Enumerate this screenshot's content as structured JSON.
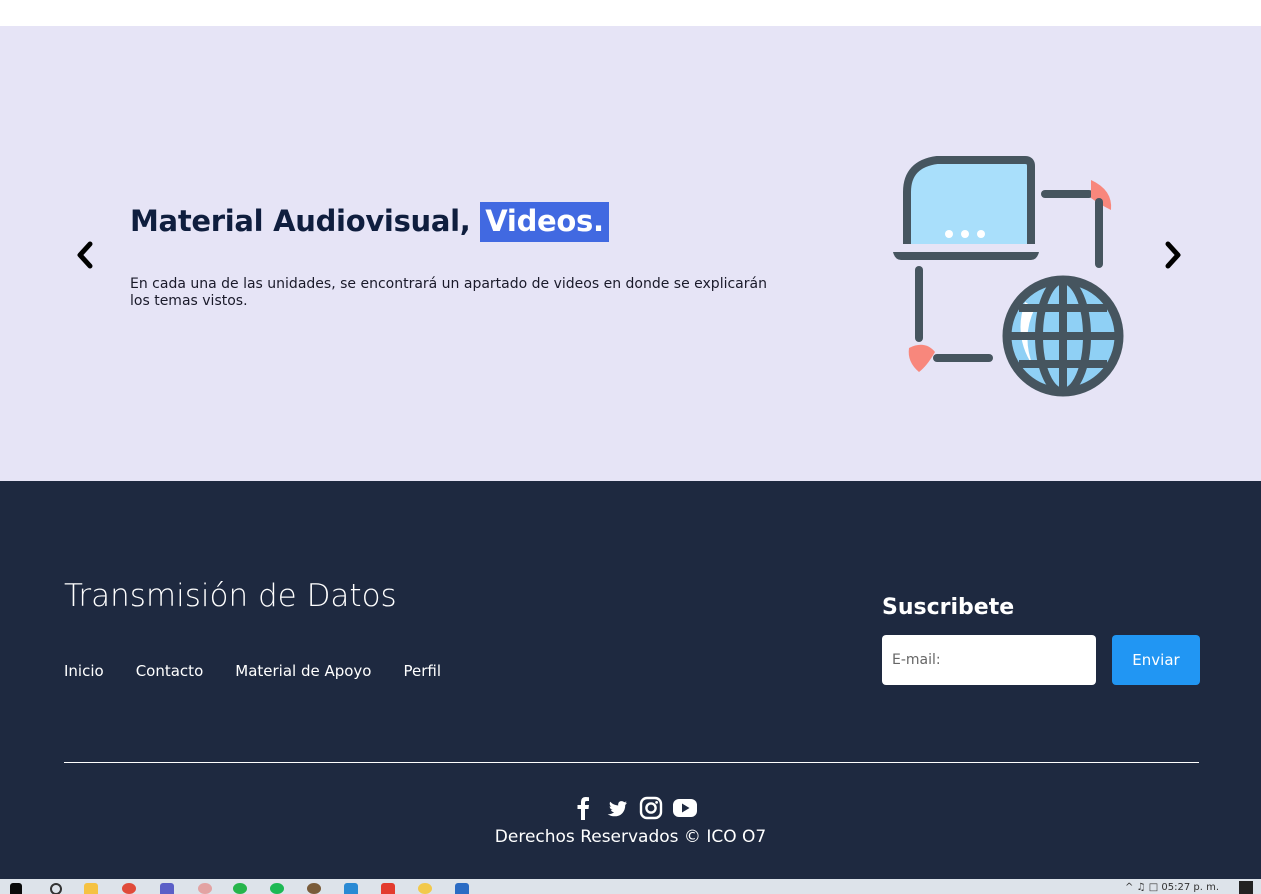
{
  "slider": {
    "title": "Material Audiovisual, ",
    "title_highlight": "Videos.",
    "description": "En cada una de las unidades, se encontrará un apartado de videos en donde se explicarán los temas vistos.",
    "prev_icon": "chevron-left-icon",
    "next_icon": "chevron-right-icon",
    "illustration_icon": "laptop-network-globe-icon"
  },
  "footer": {
    "brand": "Transmisión de Datos",
    "nav": [
      "Inicio",
      "Contacto",
      "Material de Apoyo",
      "Perfil"
    ],
    "subscribe": {
      "title": "Suscribete",
      "email_placeholder": "E-mail:",
      "button_label": "Enviar"
    },
    "socials": [
      "facebook-icon",
      "twitter-icon",
      "instagram-icon",
      "youtube-icon"
    ],
    "copyright": "Derechos Reservados © ICO O7"
  },
  "taskbar": {
    "clock": "05:27 p. m."
  },
  "colors": {
    "hero_bg": "#e6e4f6",
    "title_text": "#0f1e3e",
    "highlight_bg": "#4169e1",
    "footer_bg": "#1e2940",
    "button_bg": "#2196f3"
  }
}
